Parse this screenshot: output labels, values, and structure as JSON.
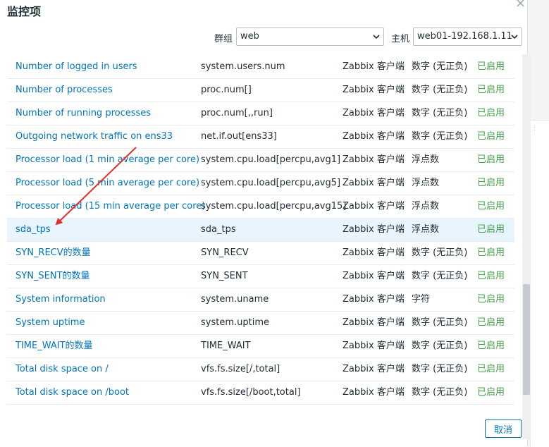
{
  "dialog": {
    "title": "监控项",
    "close_icon": "close-icon"
  },
  "filters": {
    "group_label": "群组",
    "group_value": "web",
    "host_label": "主机",
    "host_value": "web01-192.168.1.11"
  },
  "items": [
    {
      "name": "Number of logged in users",
      "key": "system.users.num",
      "type": "Zabbix 客户端",
      "value_type": "数字 (无正负)",
      "status": "已启用"
    },
    {
      "name": "Number of processes",
      "key": "proc.num[]",
      "type": "Zabbix 客户端",
      "value_type": "数字 (无正负)",
      "status": "已启用"
    },
    {
      "name": "Number of running processes",
      "key": "proc.num[,,run]",
      "type": "Zabbix 客户端",
      "value_type": "数字 (无正负)",
      "status": "已启用"
    },
    {
      "name": "Outgoing network traffic on ens33",
      "key": "net.if.out[ens33]",
      "type": "Zabbix 客户端",
      "value_type": "数字 (无正负)",
      "status": "已启用"
    },
    {
      "name": "Processor load (1 min average per core)",
      "key": "system.cpu.load[percpu,avg1]",
      "type": "Zabbix 客户端",
      "value_type": "浮点数",
      "status": "已启用"
    },
    {
      "name": "Processor load (5 min average per core)",
      "key": "system.cpu.load[percpu,avg5]",
      "type": "Zabbix 客户端",
      "value_type": "浮点数",
      "status": "已启用"
    },
    {
      "name": "Processor load (15 min average per core)",
      "key": "system.cpu.load[percpu,avg15]",
      "type": "Zabbix 客户端",
      "value_type": "浮点数",
      "status": "已启用"
    },
    {
      "name": "sda_tps",
      "key": "sda_tps",
      "type": "Zabbix 客户端",
      "value_type": "浮点数",
      "status": "已启用"
    },
    {
      "name": "SYN_RECV的数量",
      "key": "SYN_RECV",
      "type": "Zabbix 客户端",
      "value_type": "数字 (无正负)",
      "status": "已启用"
    },
    {
      "name": "SYN_SENT的数量",
      "key": "SYN_SENT",
      "type": "Zabbix 客户端",
      "value_type": "数字 (无正负)",
      "status": "已启用"
    },
    {
      "name": "System information",
      "key": "system.uname",
      "type": "Zabbix 客户端",
      "value_type": "字符",
      "status": "已启用"
    },
    {
      "name": "System uptime",
      "key": "system.uptime",
      "type": "Zabbix 客户端",
      "value_type": "数字 (无正负)",
      "status": "已启用"
    },
    {
      "name": "TIME_WAIT的数量",
      "key": "TIME_WAIT",
      "type": "Zabbix 客户端",
      "value_type": "数字 (无正负)",
      "status": "已启用"
    },
    {
      "name": "Total disk space on /",
      "key": "vfs.fs.size[/,total]",
      "type": "Zabbix 客户端",
      "value_type": "数字 (无正负)",
      "status": "已启用"
    },
    {
      "name": "Total disk space on /boot",
      "key": "vfs.fs.size[/boot,total]",
      "type": "Zabbix 客户端",
      "value_type": "数字 (无正负)",
      "status": "已启用"
    }
  ],
  "highlighted_item": "sda_tps",
  "annotation": {
    "color": "#e0302c"
  },
  "footer": {
    "cancel_label": "取消"
  },
  "colors": {
    "link": "#0275b8",
    "status_enabled": "#429e47",
    "highlight_row": "#e8f5ff"
  }
}
